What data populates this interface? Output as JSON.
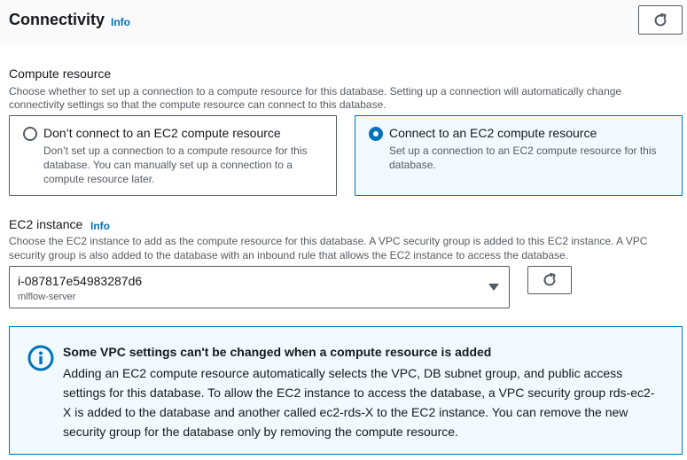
{
  "header": {
    "title": "Connectivity",
    "info_label": "Info"
  },
  "compute_resource": {
    "label": "Compute resource",
    "description_line1": "Choose whether to set up a connection to a compute resource for this database. Setting up a connection will automatically change",
    "description_line2": "connectivity settings so that the compute resource can connect to this database.",
    "options": [
      {
        "label": "Don’t connect to an EC2 compute resource",
        "description_lines": [
          "Don’t set up a connection to a compute resource for this",
          "database. You can manually set up a connection to a",
          "compute resource later."
        ],
        "selected": false
      },
      {
        "label": "Connect to an EC2 compute resource",
        "description_lines": [
          "Set up a connection to an EC2 compute resource for this",
          "database."
        ],
        "selected": true
      }
    ]
  },
  "ec2_instance": {
    "label": "EC2 instance",
    "info_label": "Info",
    "description_line1": "Choose the EC2 instance to add as the compute resource for this database. A VPC security group is added to this EC2 instance. A VPC",
    "description_line2": "security group is also added to the database with an inbound rule that allows the EC2 instance to access the database.",
    "selected_value": "i-087817e54983287d6",
    "selected_name": "mlflow-server"
  },
  "alert": {
    "title": "Some VPC settings can't be changed when a compute resource is added",
    "lines": [
      "Adding an EC2 compute resource automatically selects the VPC, DB subnet group, and public access",
      "settings for this database. To allow the EC2 instance to access the database, a VPC security group rds-ec2-",
      "X is added to the database and another called ec2-rds-X to the EC2 instance. You can remove the new",
      "security group for the database only by removing the compute resource."
    ]
  },
  "colors": {
    "accent": "#0073bb",
    "selected_tile_bg": "#f1faff",
    "border": "#545b64"
  },
  "icons": {
    "refresh": "refresh-icon",
    "dropdown": "caret-down-icon",
    "alert": "info-circle-icon"
  }
}
